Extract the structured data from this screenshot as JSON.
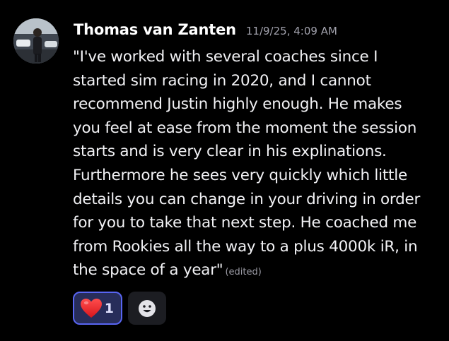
{
  "message": {
    "author": "Thomas van Zanten",
    "timestamp": "11/9/25, 4:09 AM",
    "content_lines": [
      "\"I've worked with several coaches since I",
      "started sim racing in 2020, and I cannot",
      "recommend Justin highly enough. He makes",
      "you feel at ease from the moment the session",
      "starts and is very clear in his explinations.",
      "Furthermore he sees very quickly which little",
      "details you can change in your driving in order",
      "for you to take that next step. He coached me",
      "from Rookies all the way to a plus 4000k iR, in",
      "the space of a year\""
    ],
    "edited_label": "(edited)"
  },
  "reactions": [
    {
      "emoji": "heart-icon",
      "count": "1",
      "selected": true
    }
  ],
  "add_reaction": {
    "icon": "smiley-icon"
  },
  "colors": {
    "background": "#000000",
    "accent": "#5865f2",
    "reaction_selected_bg": "#272d5a",
    "timestamp": "#a2a2ad"
  }
}
